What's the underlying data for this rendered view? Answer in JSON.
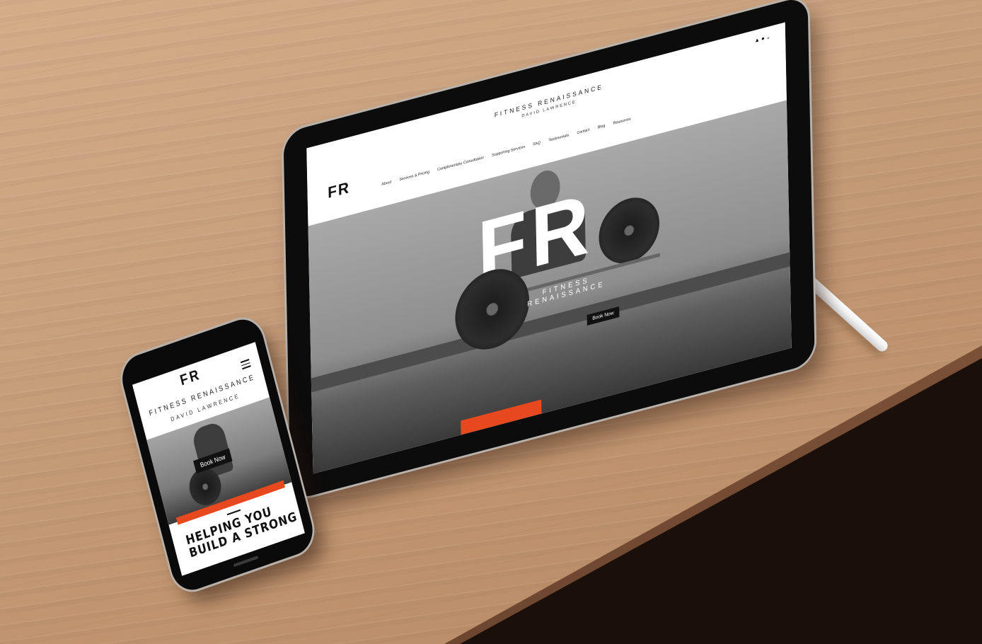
{
  "tablet": {
    "logo": "FR",
    "brand_title": "FITNESS RENAISSANCE",
    "brand_subtitle": "DAVID LAWRENCE",
    "icons": "▲ ● ⌄",
    "nav": [
      "About",
      "Services & Pricing",
      "Complimentary Consultation",
      "Supporting Services",
      "FAQ",
      "Testimonials",
      "Contact",
      "Blog",
      "Resources"
    ],
    "hero_logo": "FR",
    "hero_title": "FITNESS RENAISSANCE",
    "book_button": "Book Now",
    "accent_color": "#e8481d"
  },
  "phone": {
    "logo": "FR",
    "brand_title": "FITNESS RENAISSANCE",
    "brand_subtitle": "DAVID LAWRENCE",
    "book_button": "Book Now",
    "headline": "HELPING YOU BUILD A STRONG",
    "accent_color": "#e8481d"
  }
}
